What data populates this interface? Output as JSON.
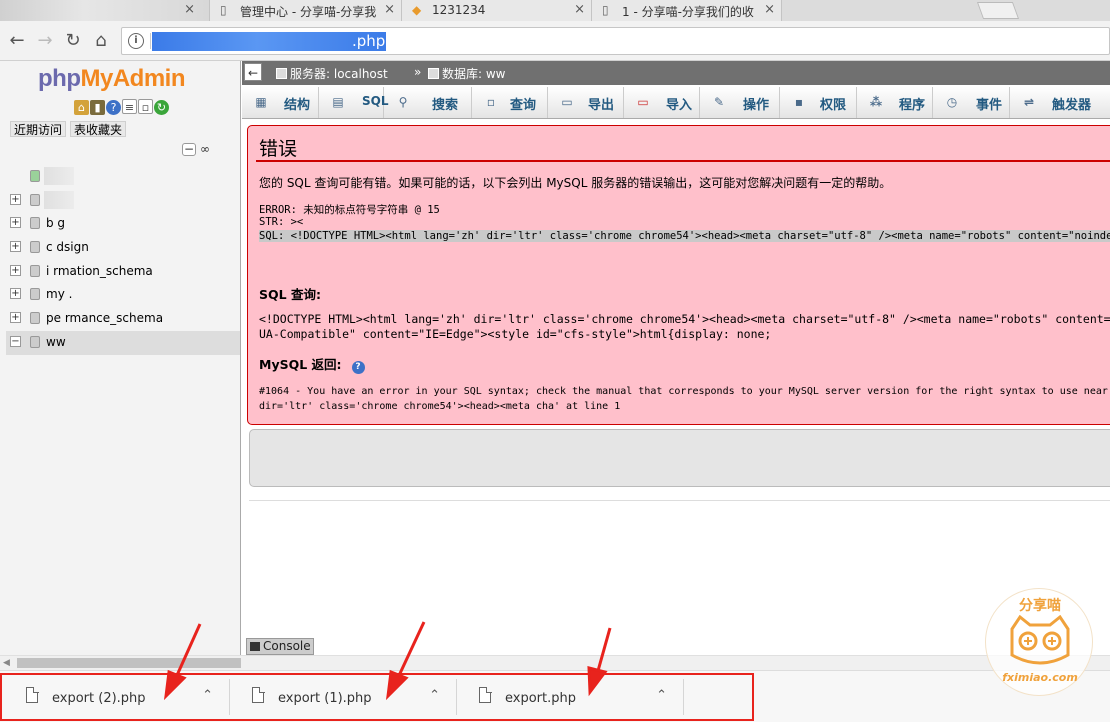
{
  "browser": {
    "tabs": [
      {
        "title": "管理中心 - 分享喵-分享我",
        "icon": "page-icon"
      },
      {
        "title": "1231234",
        "icon": "phpmyadmin-favicon"
      },
      {
        "title": "1 - 分享喵-分享我们的收",
        "icon": "page-icon"
      }
    ],
    "close_glyph": "×",
    "url_visible": ".php"
  },
  "sidebar": {
    "logo": {
      "php": "php",
      "my": "My",
      "admin": "Admin"
    },
    "quick_icons": [
      "home-icon",
      "logout-icon",
      "help-icon",
      "docs-icon",
      "settings-icon",
      "reload-icon"
    ],
    "tabs": {
      "recent": "近期访问",
      "favorites": "表收藏夹"
    },
    "databases": [
      {
        "name": "",
        "masked": true,
        "new": true
      },
      {
        "name": "",
        "masked": true
      },
      {
        "name": "b  g",
        "masked": true
      },
      {
        "name": "c   dsign",
        "masked": true
      },
      {
        "name": "i    rmation_schema",
        "masked": true
      },
      {
        "name": "my   .",
        "masked": true
      },
      {
        "name": "pe   rmance_schema",
        "masked": true
      },
      {
        "name": "ww",
        "masked": false,
        "selected": true
      }
    ]
  },
  "breadcrumb": {
    "server_label": "服务器: localhost",
    "separator": "»",
    "db_label": "数据库: ww"
  },
  "menu": [
    {
      "label": "结构",
      "icon": "structure-icon"
    },
    {
      "label": "SQL",
      "icon": "sql-icon"
    },
    {
      "label": "搜索",
      "icon": "search-icon"
    },
    {
      "label": "查询",
      "icon": "query-icon"
    },
    {
      "label": "导出",
      "icon": "export-icon"
    },
    {
      "label": "导入",
      "icon": "import-icon"
    },
    {
      "label": "操作",
      "icon": "operations-icon"
    },
    {
      "label": "权限",
      "icon": "privileges-icon"
    },
    {
      "label": "程序",
      "icon": "routines-icon"
    },
    {
      "label": "事件",
      "icon": "events-icon"
    },
    {
      "label": "触发器",
      "icon": "triggers-icon"
    }
  ],
  "error": {
    "title": "错误",
    "intro": "您的 SQL 查询可能有错。如果可能的话，以下会列出 MySQL 服务器的错误输出，这可能对您解决问题有一定的帮助。",
    "error_line": "ERROR: 未知的标点符号字符串 @ 15",
    "str_line": "STR: ><",
    "sql_line": "SQL: <!DOCTYPE HTML><html lang='zh' dir='ltr' class='chrome chrome54'><head><meta charset=\"utf-8\" /><meta name=\"robots\" content=\"noindex,nofol",
    "sql_query_heading": "SQL 查询:",
    "sql_query_line1": "<!DOCTYPE HTML><html lang='zh' dir='ltr' class='chrome chrome54'><head><meta charset=\"utf-8\" /><meta name=\"robots\" content=\"noinde",
    "sql_query_line2": "UA-Compatible\" content=\"IE=Edge\"><style id=\"cfs-style\">html{display: none;",
    "mysql_return_heading": "MySQL 返回:",
    "mysql_line1": "#1064 - You have an error in your SQL syntax; check the manual that corresponds to your MySQL server version for the right syntax to use near",
    "mysql_line2": "dir='ltr' class='chrome chrome54'><head><meta cha' at line 1"
  },
  "console_label": "Console",
  "downloads": [
    {
      "filename": "export (2).php"
    },
    {
      "filename": "export (1).php"
    },
    {
      "filename": "export.php"
    }
  ],
  "watermark": {
    "top": "分享喵",
    "bottom": "fximiao.com"
  }
}
